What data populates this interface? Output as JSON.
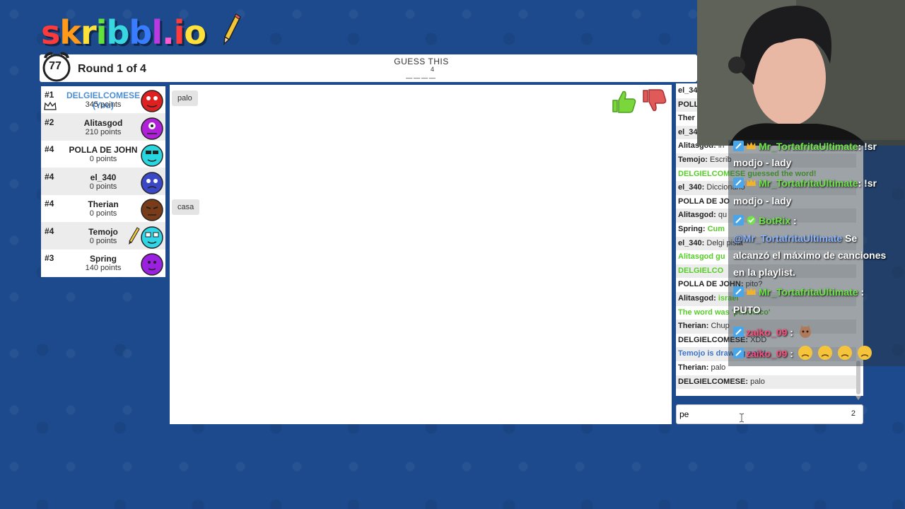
{
  "app": {
    "logo_text": "skribbl.io"
  },
  "topbar": {
    "timer": "77",
    "round": "Round 1 of 4",
    "guess_label": "GUESS THIS",
    "guess_letter_count": "4",
    "guess_blanks": "____"
  },
  "players": [
    {
      "rank": "#1",
      "name": "DELGIELCOMESE (You)",
      "points": "345 points",
      "color": "#e02020"
    },
    {
      "rank": "#2",
      "name": "Alitasgod",
      "points": "210 points",
      "color": "#b020d8"
    },
    {
      "rank": "#4",
      "name": "POLLA DE JOHN",
      "points": "0 points",
      "color": "#28d6e0"
    },
    {
      "rank": "#4",
      "name": "el_340",
      "points": "0 points",
      "color": "#3a48c8"
    },
    {
      "rank": "#4",
      "name": "Therian",
      "points": "0 points",
      "color": "#7a3c18"
    },
    {
      "rank": "#4",
      "name": "Temojo",
      "points": "0 points",
      "color": "#30d6e6"
    },
    {
      "rank": "#3",
      "name": "Spring",
      "points": "140 points",
      "color": "#9b20e0"
    }
  ],
  "canvas": {
    "bubbles": [
      "palo",
      "casa"
    ]
  },
  "chat": [
    {
      "user": "el_34",
      "msg": "",
      "style": "normal"
    },
    {
      "user": "POLL",
      "msg": "",
      "style": "normal"
    },
    {
      "user": "Ther",
      "msg": "",
      "style": "normal"
    },
    {
      "user": "el_34",
      "msg": "",
      "style": "normal"
    },
    {
      "user": "Alitasgod:",
      "msg": "in",
      "style": "normal"
    },
    {
      "user": "Temojo:",
      "msg": "Escrib",
      "style": "normal"
    },
    {
      "user": "",
      "msg": "DELGIELCOMESE guessed the word!",
      "style": "green"
    },
    {
      "user": "el_340:",
      "msg": "Diccionario",
      "style": "normal"
    },
    {
      "user": "POLLA DE JO",
      "msg": "",
      "style": "normal"
    },
    {
      "user": "Alitasgod:",
      "msg": "qu",
      "style": "normal"
    },
    {
      "user": "Spring:",
      "msg": "Cum",
      "style": "green"
    },
    {
      "user": "el_340:",
      "msg": "Delgi pista",
      "style": "normal"
    },
    {
      "user": "",
      "msg": "Alitasgod gu",
      "style": "green"
    },
    {
      "user": "",
      "msg": "DELGIELCO",
      "style": "green"
    },
    {
      "user": "POLLA DE JOHN:",
      "msg": "pito?",
      "style": "normal"
    },
    {
      "user": "Alitasgod:",
      "msg": "israel",
      "style": "green"
    },
    {
      "user": "",
      "msg": "The word was 'periodico'",
      "style": "green"
    },
    {
      "user": "Therian:",
      "msg": "Chup",
      "style": "normal"
    },
    {
      "user": "DELGIELCOMESE:",
      "msg": "XDD",
      "style": "normal"
    },
    {
      "user": "",
      "msg": "Temojo is drawing now!",
      "style": "blue"
    },
    {
      "user": "Therian:",
      "msg": "palo",
      "style": "normal"
    },
    {
      "user": "DELGIELCOMESE:",
      "msg": "palo",
      "style": "normal"
    }
  ],
  "chat_input": {
    "value": "pe",
    "count": "2"
  },
  "stream_chat": [
    {
      "user": "Mr_TortafritaUltimate",
      "text": ": !sr"
    },
    {
      "user": "",
      "text": "modjo - lady"
    },
    {
      "user": "Mr_TortafritaUltimate",
      "text": ": !sr"
    },
    {
      "user": "",
      "text": "modjo - lady"
    },
    {
      "user": "BotRix",
      "text": ":"
    },
    {
      "user": "",
      "mention": "@Mr_TortafritaUltimate",
      "text": " Se"
    },
    {
      "user": "",
      "text": "alcanzó el máximo de canciones"
    },
    {
      "user": "",
      "text": "en la playlist."
    },
    {
      "user": "Mr_TortafritaUltimate",
      "text": ":"
    },
    {
      "user": "",
      "text": "PUTO"
    },
    {
      "user": "zaiko_09",
      "text": ":"
    },
    {
      "user": "zaiko_09",
      "text": ":"
    }
  ]
}
